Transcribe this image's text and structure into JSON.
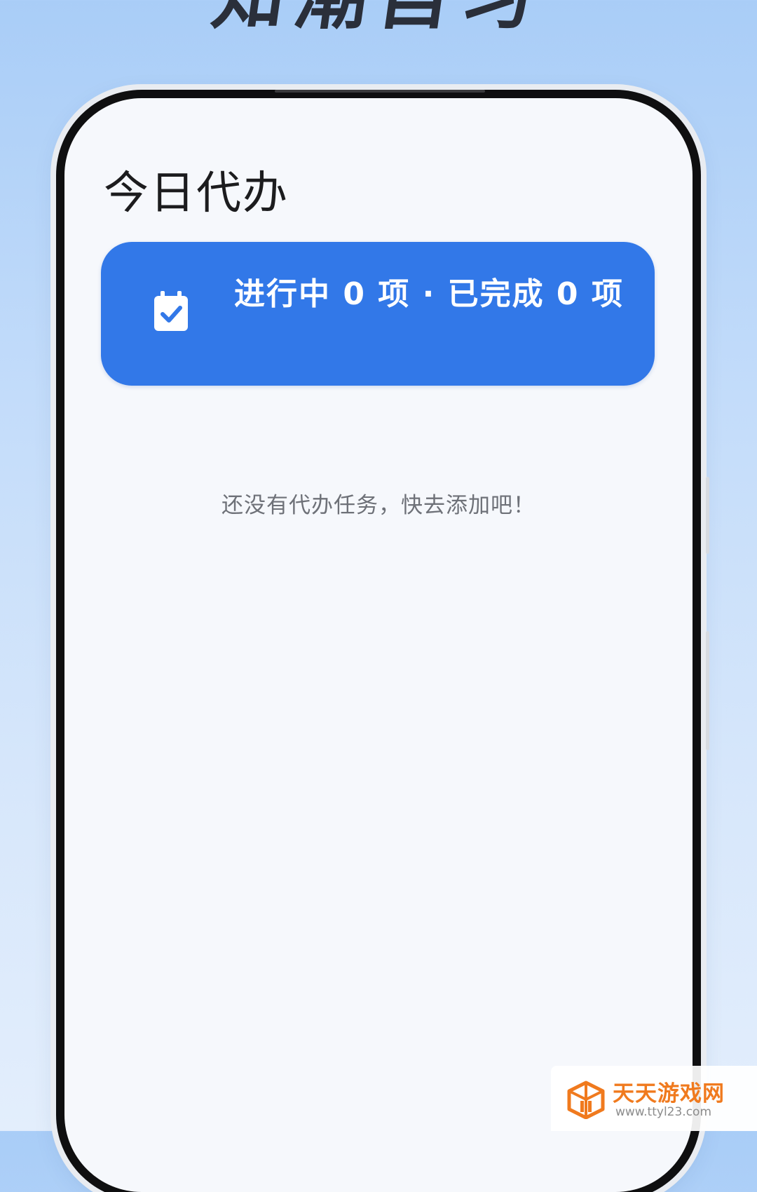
{
  "promo": {
    "title": "知潮自习"
  },
  "screen": {
    "title": "今日代办",
    "summary_card": {
      "text": "进行中 0 项 · 已完成 0 项",
      "in_progress_count": 0,
      "completed_count": 0,
      "icon": "calendar-check-icon",
      "color": "#3278e8"
    },
    "empty_state": "还没有代办任务，快去添加吧！"
  },
  "watermark": {
    "name": "天天游戏网",
    "url": "www.ttyl23.com"
  }
}
